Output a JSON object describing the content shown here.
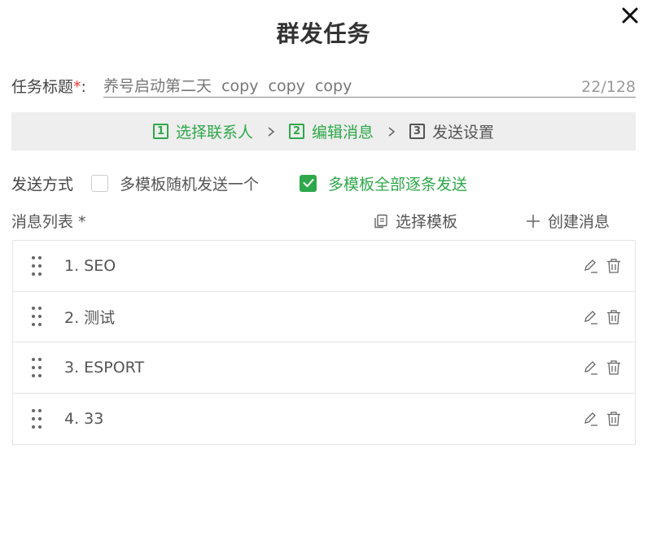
{
  "dialog": {
    "title": "群发任务"
  },
  "task": {
    "label": "任务标题",
    "required_mark": "*",
    "colon": ":",
    "value": "养号启动第二天  copy  copy  copy",
    "char_count": "22/128"
  },
  "steps": [
    {
      "number": "1",
      "label": "选择联系人",
      "state": "active"
    },
    {
      "number": "2",
      "label": "编辑消息",
      "state": "active"
    },
    {
      "number": "3",
      "label": "发送设置",
      "state": "inactive"
    }
  ],
  "send_mode": {
    "label": "发送方式",
    "options": [
      {
        "label": "多模板随机发送一个",
        "checked": false
      },
      {
        "label": "多模板全部逐条发送",
        "checked": true
      }
    ]
  },
  "messages": {
    "title": "消息列表 *",
    "select_template_label": "选择模板",
    "create_label": "创建消息",
    "items": [
      {
        "label": "1. SEO"
      },
      {
        "label": "2. 测试"
      },
      {
        "label": "3. ESPORT"
      },
      {
        "label": "4. 33"
      }
    ]
  },
  "colors": {
    "accent": "#2ea84a",
    "required": "#e53935",
    "step_bar_bg": "#eeeeee"
  },
  "icons": {
    "close": "close-icon",
    "chevron": "chevron-right-icon",
    "template": "copy-icon",
    "create": "plus-icon",
    "drag": "drag-handle-icon",
    "edit": "pencil-icon",
    "delete": "trash-icon"
  }
}
